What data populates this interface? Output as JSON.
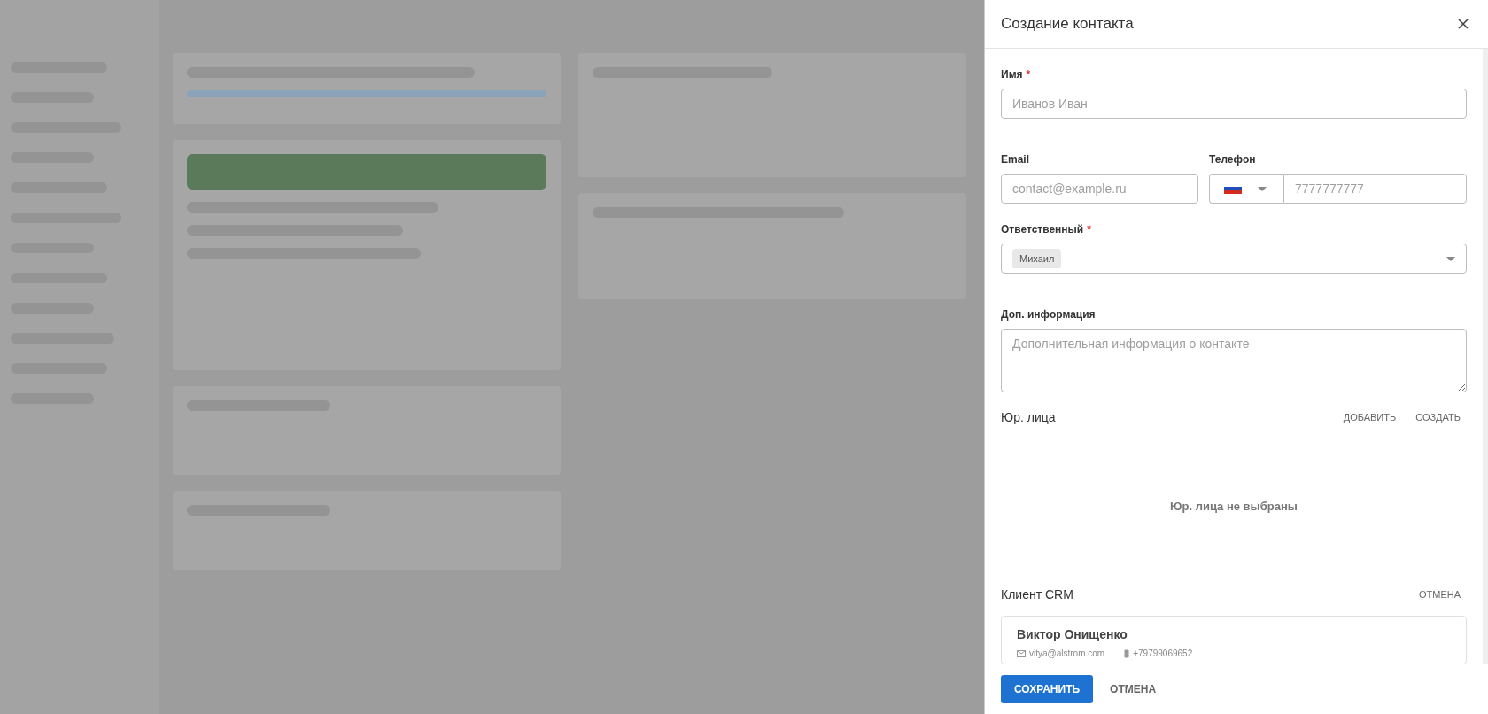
{
  "drawer": {
    "title": "Создание контакта",
    "fields": [
      {
        "kind": "text",
        "label": "Имя",
        "required_mark": "*",
        "placeholder": "Иванов Иван"
      }
    ],
    "row": [
      {
        "kind": "text",
        "label": "Email",
        "placeholder": "contact@example.ru"
      },
      {
        "kind": "phone",
        "label": "Телефон",
        "placeholder": "7777777777"
      }
    ],
    "responsible": {
      "label": "Ответственный",
      "required_mark": "*",
      "chips": [
        "Михаил"
      ]
    },
    "notes": {
      "label": "Доп. информация",
      "placeholder": "Дополнительная информация о контакте"
    },
    "legal": {
      "title": "Юр. лица",
      "actions": [
        "ДОБАВИТЬ",
        "СОЗДАТЬ"
      ],
      "empty": "Юр. лица не выбраны"
    },
    "client": {
      "title": "Клиент CRM",
      "action": "ОТМЕНА",
      "name": "Виктор Онищенко",
      "email": "vitya@alstrom.com",
      "phone": "+79799069652"
    },
    "footer": {
      "save": "СОХРАНИТЬ",
      "cancel": "ОТМЕНА"
    }
  }
}
